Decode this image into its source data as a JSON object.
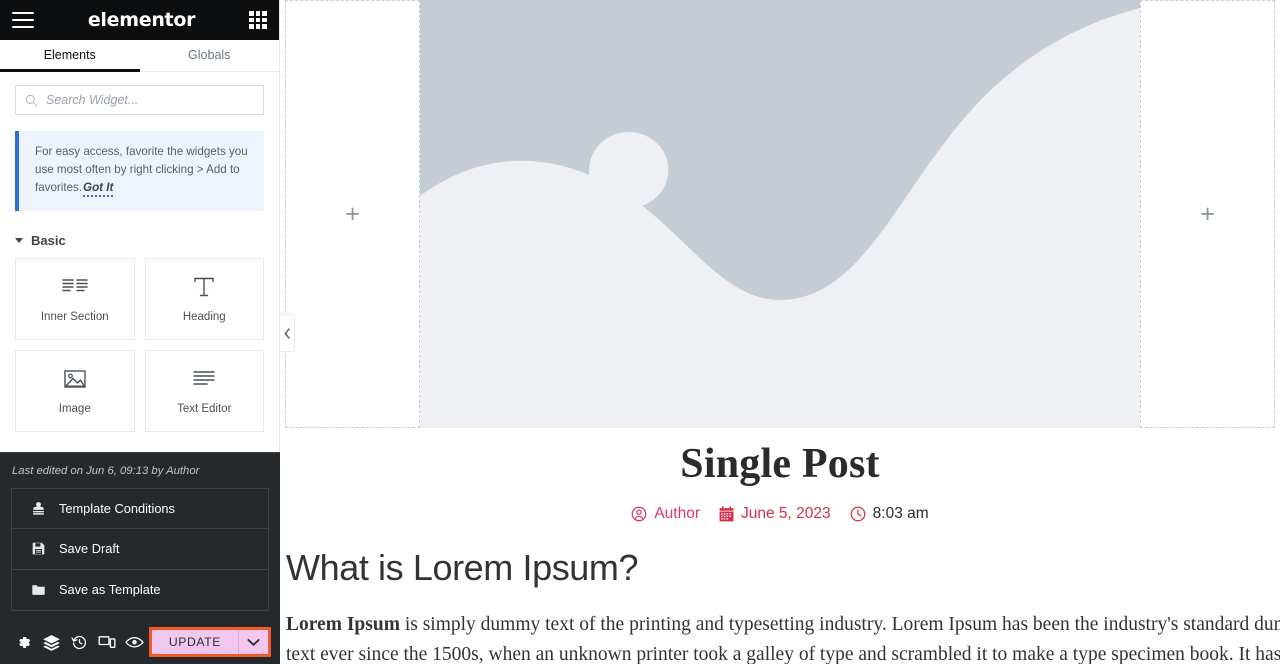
{
  "panel": {
    "brand": "elementor",
    "menu_icon": "hamburger-icon",
    "apps_icon": "grid-apps-icon",
    "tabs": [
      {
        "label": "Elements",
        "active": true
      },
      {
        "label": "Globals",
        "active": false
      }
    ],
    "search": {
      "placeholder": "Search Widget...",
      "value": "",
      "icon": "search-icon"
    },
    "notice": {
      "text": "For easy access, favorite the widgets you use most often by right clicking > Add to favorites.",
      "action_label": "Got It",
      "accent_color": "#2e6ede",
      "background_color": "#eef4fd"
    },
    "category": {
      "title": "Basic",
      "expanded": true
    },
    "widgets": [
      {
        "label": "Inner Section",
        "icon": "inner-section-icon"
      },
      {
        "label": "Heading",
        "icon": "heading-t-icon"
      },
      {
        "label": "Image",
        "icon": "image-icon"
      },
      {
        "label": "Text Editor",
        "icon": "text-editor-icon"
      }
    ]
  },
  "save_panel": {
    "last_edited": "Last edited on Jun 6, 09:13 by Author",
    "menu": [
      {
        "label": "Template Conditions",
        "icon": "stamp-icon"
      },
      {
        "label": "Save Draft",
        "icon": "floppy-disk-icon"
      },
      {
        "label": "Save as Template",
        "icon": "folder-icon"
      }
    ],
    "footer_icons": [
      {
        "name": "settings-gear-icon"
      },
      {
        "name": "navigator-layers-icon"
      },
      {
        "name": "history-clock-icon"
      },
      {
        "name": "responsive-devices-icon"
      },
      {
        "name": "preview-eye-icon"
      }
    ],
    "update_button": {
      "label": "UPDATE",
      "dropdown_icon": "chevron-down-icon",
      "background_color": "#f2c8f0",
      "highlight_color": "#f15a29"
    }
  },
  "collapse_handle": {
    "icon": "chevron-left-icon"
  },
  "canvas": {
    "left_column": {
      "add_icon": "plus-icon",
      "label": "+"
    },
    "right_column": {
      "add_icon": "plus-icon",
      "label": "+"
    },
    "hero": {
      "name": "featured-image-placeholder",
      "sky_color": "#c6ccd3",
      "land_color": "#eef0f3",
      "sun_color": "#eef0f3"
    },
    "post": {
      "title": "Single Post",
      "meta": {
        "author": {
          "label": "Author",
          "icon": "user-circle-icon",
          "color": "#d93a63"
        },
        "date": {
          "label": "June 5, 2023",
          "icon": "calendar-icon",
          "color": "#d8304a"
        },
        "time": {
          "label": "8:03 am",
          "icon": "clock-icon",
          "color": "#2b2b2b"
        }
      },
      "heading": "What is Lorem Ipsum?",
      "body_lead": "Lorem Ipsum",
      "body_line1": " is simply dummy text of the printing and typesetting industry. Lorem Ipsum has been the industry's standard dummy",
      "body_line2": "text ever since the 1500s, when an unknown printer took a galley of type and scrambled it to make a type specimen book. It has"
    }
  }
}
